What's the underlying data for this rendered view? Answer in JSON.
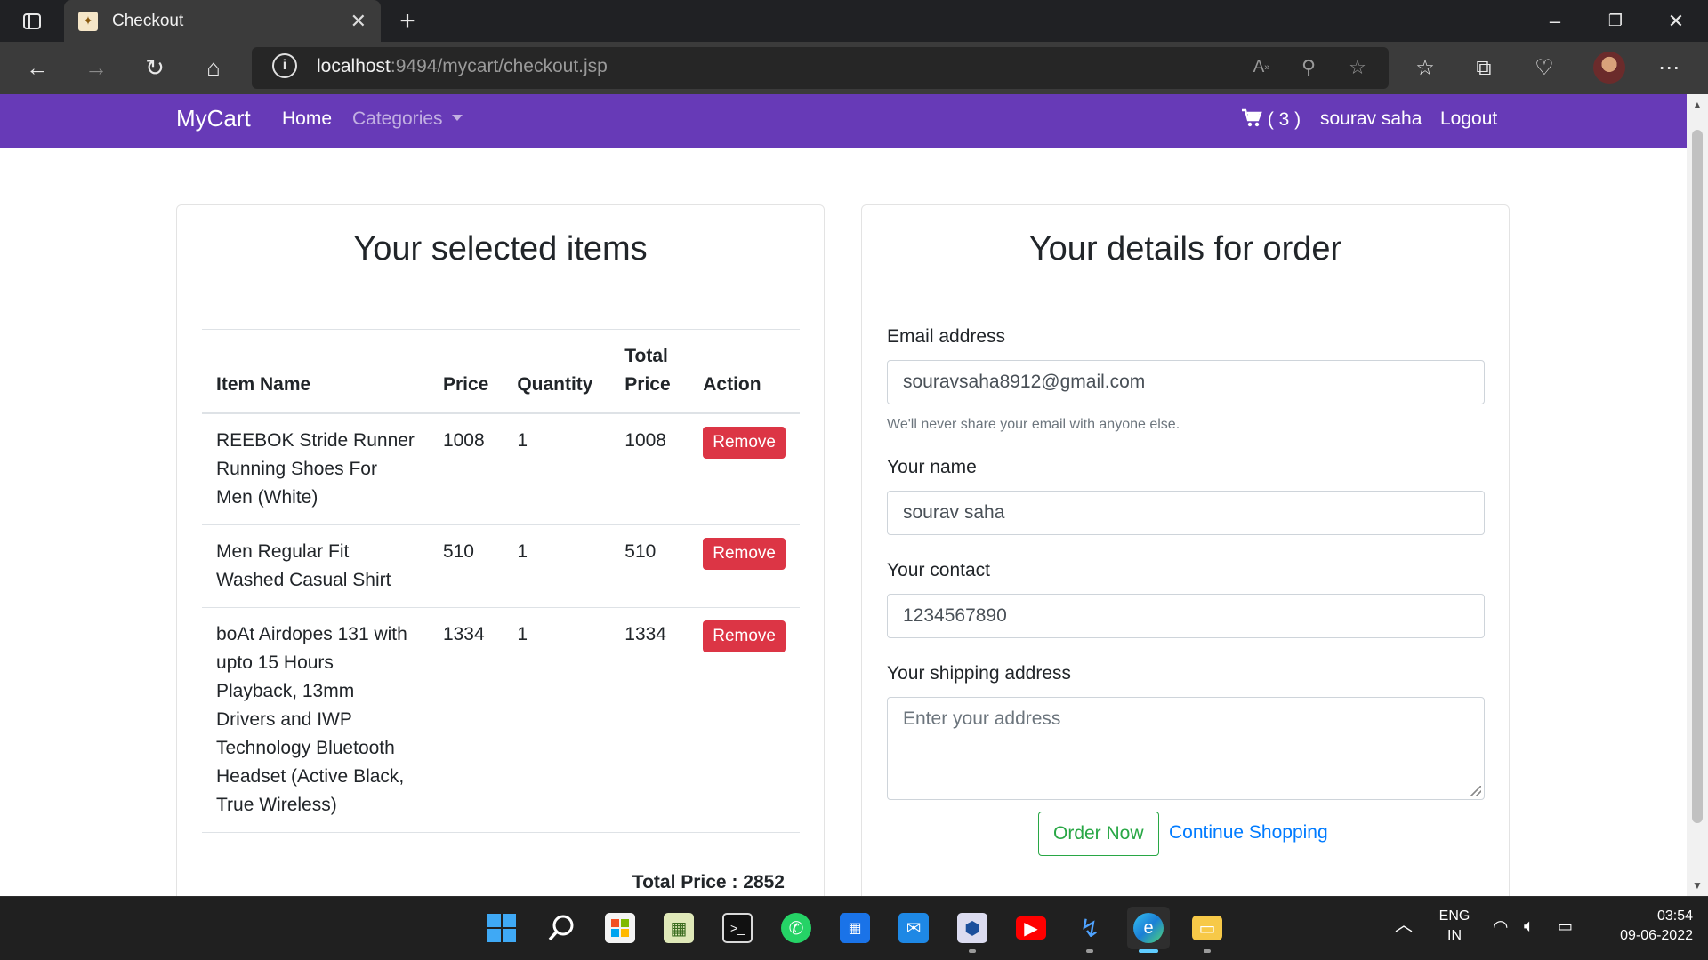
{
  "browser": {
    "tab_title": "Checkout",
    "url_host": "localhost",
    "url_rest": ":9494/mycart/checkout.jsp"
  },
  "navbar": {
    "brand": "MyCart",
    "home": "Home",
    "categories": "Categories",
    "cart_count": "( 3 )",
    "user": "sourav saha",
    "logout": "Logout",
    "bg_color": "#673ab7"
  },
  "items_card": {
    "title": "Your selected items",
    "headers": {
      "name": "Item Name",
      "price": "Price",
      "quantity": "Quantity",
      "total": "Total Price",
      "action": "Action"
    },
    "rows": [
      {
        "name": "REEBOK Stride Runner Running Shoes For Men (White)",
        "price": "1008",
        "quantity": "1",
        "total": "1008",
        "action": "Remove"
      },
      {
        "name": "Men Regular Fit Washed Casual Shirt",
        "price": "510",
        "quantity": "1",
        "total": "510",
        "action": "Remove"
      },
      {
        "name": "boAt Airdopes 131 with upto 15 Hours Playback, 13mm Drivers and IWP Technology Bluetooth Headset (Active Black, True Wireless)",
        "price": "1334",
        "quantity": "1",
        "total": "1334",
        "action": "Remove"
      }
    ],
    "grand_total": "Total Price : 2852"
  },
  "order_card": {
    "title": "Your details for order",
    "email_label": "Email address",
    "email_value": "souravsaha8912@gmail.com",
    "email_help": "We'll never share your email with anyone else.",
    "name_label": "Your name",
    "name_value": "sourav saha",
    "contact_label": "Your contact",
    "contact_value": "1234567890",
    "address_label": "Your shipping address",
    "address_placeholder": "Enter your address",
    "order_button": "Order Now",
    "continue_link": "Continue Shopping"
  },
  "taskbar": {
    "lang_top": "ENG",
    "lang_bottom": "IN",
    "time": "03:54",
    "date": "09-06-2022"
  }
}
